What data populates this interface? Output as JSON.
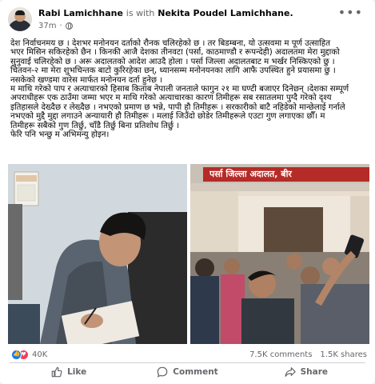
{
  "post": {
    "author": "Rabi Lamichhane",
    "with_text": "is with",
    "tagged": "Nekita Poudel Lamichhane.",
    "time": "37m",
    "body": "देश निर्वाचनमय छ । देशभर मनोनयन दर्ताको रौनक चलिरहेको छ । तर बिडम्बना, यो उत्सवमा म पूर्ण उत्साहित\nभएर मिसिन सकिरहेको छैन । किनकी आजै देशका तीनवटा (पर्सा, काठमाण्डौ र रूपन्देही)  अदालतमा मेरा मुद्दाको\nसुनुवाई चलिरहेको छ । अरू अदालतको आदेश आउदै होला । पर्सा जिल्ला अदालतबाट म भर्खर निस्किएको छु ।\nचितवन-२ मा मेरा शुभचिन्तक बाटो कुरिरहेका छन्, ध्यानसम्म मनोनयनका लागि आफै उपस्थित हुने प्रयासमा छु ।\nनसकेको खण्डमा वारेस मार्फत मनोनयन दर्ता हुनेछ ।\nम माथि गरेको पाप र अत्याचारको हिसाब किताब नेपाली जनताले फागुन २१ मा घण्टी बजाएर दिनेछन् ।देशका सम्पूर्ण\nअपराधीहरू एक ठाउँमा जम्मा भएर म माथि गरेको अत्याचारका कारण तिमीहरू सब रसातलमा पुग्दै गरेको दृश्य\nइतिहासले देख्दैछ र लेख्दैछ । नभएको प्रमाण छ भन्ने, पापी हौ तिमीहरू । सरकारीको बाटै नहिडेको मान्छेलाई गर्नाले\nनभएको मुद्दै मुद्दा लगाउने अन्यायारी हौ तिमीहरू । मलाई जिउँदो छोडेर तिमीहरूले एउटा गुण लगाएका छौँ। म\nतिमीहरू सबैको गुण तिर्छु, चाँडै तिर्छु बिना प्रतिशोध तिर्छु ।\nफेरि पनि भन्छु म अभिमन्यु  होइन।",
    "photo_right_sign": "पर्सा जिल्ला अदालत, बीर",
    "reactions_count": "40K",
    "comments": "7.5K comments",
    "shares": "1.5K shares",
    "like_label": "Like",
    "comment_label": "Comment",
    "share_label": "Share"
  },
  "colors": {
    "brand": "#1877f2",
    "love": "#f33e58",
    "muted": "#65676b",
    "sign_red": "#b52b27"
  },
  "icons": [
    "more-icon",
    "globe-icon",
    "like-reaction-icon",
    "love-reaction-icon",
    "like-icon",
    "comment-icon",
    "share-icon"
  ]
}
